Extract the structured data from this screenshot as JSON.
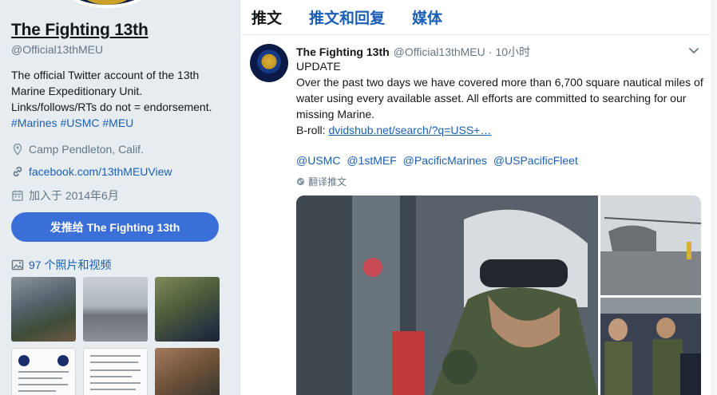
{
  "profile": {
    "name": "The Fighting 13th",
    "handle": "@Official13thMEU",
    "bio_text": "The official Twitter account of the 13th Marine Expeditionary Unit. Links/follows/RTs do not = endorsement.",
    "bio_tags": "#Marines #USMC #MEU",
    "location": "Camp Pendleton, Calif.",
    "website": "facebook.com/13thMEUView",
    "joined": "加入于 2014年6月",
    "tweet_to_button": "发推给 The Fighting 13th",
    "media_link": "97 个照片和视频",
    "icons": {
      "location": "map-pin-icon",
      "website": "link-icon",
      "joined": "calendar-icon",
      "media": "photo-icon"
    }
  },
  "timeline": {
    "tabs": [
      {
        "label": "推文",
        "active": true
      },
      {
        "label": "推文和回复",
        "active": false
      },
      {
        "label": "媒体",
        "active": false
      }
    ]
  },
  "tweet": {
    "author_name": "The Fighting 13th",
    "author_handle": "@Official13thMEU",
    "separator": "·",
    "time": "10小时",
    "line1": "UPDATE",
    "line2": "Over the past two days we have covered more than 6,700 square nautical miles of water using every available asset.  All efforts are committed to searching for our missing Marine.",
    "broll_prefix": "B-roll: ",
    "broll_link": "dvidshub.net/search/?q=USS+…",
    "mentions": [
      "@USMC",
      "@1stMEF",
      "@PacificMarines",
      "@USPacificFleet"
    ],
    "translate_label": "翻译推文"
  },
  "colors": {
    "accent": "#1b5fb5",
    "button": "#3a6fd8",
    "background": "#e6ecf0"
  }
}
